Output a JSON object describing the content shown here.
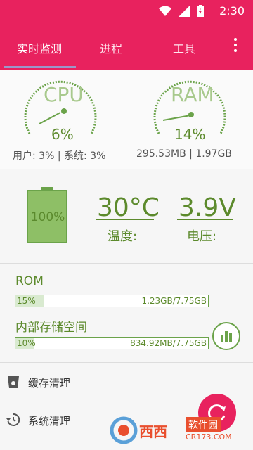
{
  "status_bar": {
    "time": "2:30"
  },
  "tabs": [
    {
      "label": "实时监测",
      "active": true
    },
    {
      "label": "进程",
      "active": false
    },
    {
      "label": "工具",
      "active": false
    }
  ],
  "cpu": {
    "label": "CPU",
    "value": "6%",
    "detail": "用户: 3% | 系统: 3%"
  },
  "ram": {
    "label": "RAM",
    "value": "14%",
    "detail": "295.53MB | 1.97GB"
  },
  "battery": {
    "level": "100%",
    "fraction": 1.0
  },
  "temperature": {
    "value": "30°C",
    "label": "温度:"
  },
  "voltage": {
    "value": "3.9V",
    "label": "电压:"
  },
  "rom": {
    "title": "ROM",
    "percent": "15%",
    "fraction": 0.15,
    "size": "1.23GB/7.75GB"
  },
  "internal": {
    "title": "内部存储空间",
    "percent": "10%",
    "fraction": 0.1,
    "size": "834.92MB/7.75GB"
  },
  "list": [
    {
      "label": "缓存清理",
      "icon": "trash-icon"
    },
    {
      "label": "系统清理",
      "icon": "history-icon"
    }
  ],
  "watermark": {
    "brand": "西西",
    "site": "软件园",
    "url": "CR173.COM"
  },
  "colors": {
    "accent": "#e8225e",
    "green": "#5c8a2c",
    "light_green": "#a8c98d"
  }
}
